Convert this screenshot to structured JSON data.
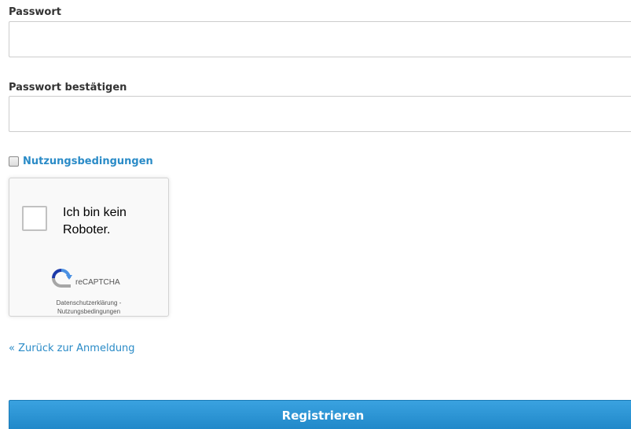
{
  "form": {
    "password_label": "Passwort",
    "password_value": "",
    "password_placeholder": "",
    "confirm_label": "Passwort bestätigen",
    "confirm_value": "",
    "confirm_placeholder": "",
    "terms_checked": false,
    "terms_link": "Nutzungsbedingungen",
    "back_link": "« Zurück zur Anmeldung",
    "submit_label": "Registrieren"
  },
  "captcha": {
    "label": "Ich bin kein Roboter.",
    "brand": "reCAPTCHA",
    "privacy_link": "Datenschutzerklärung",
    "separator": "-",
    "terms_link": "Nutzungsbedingungen",
    "logo_icon": "recaptcha-logo-icon"
  },
  "colors": {
    "link": "#2a8bc7",
    "button": "#2a93d5",
    "captcha_bg": "#f9f9f9"
  }
}
